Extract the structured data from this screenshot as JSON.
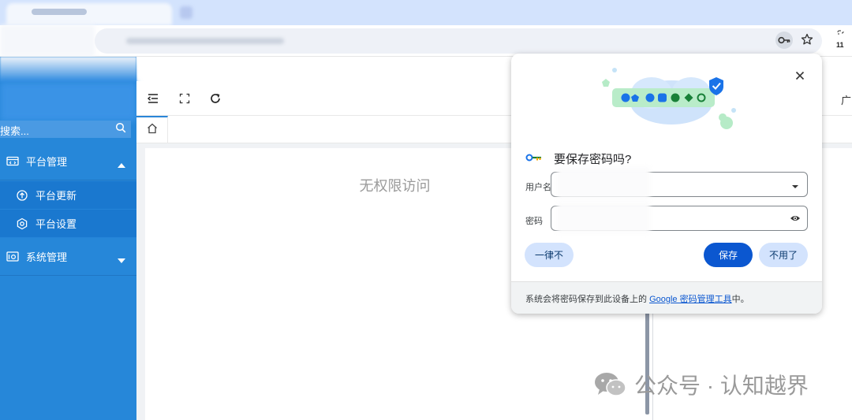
{
  "browser": {
    "extension_badge": "11"
  },
  "sidebar": {
    "search_placeholder": "搜索...",
    "groups": [
      {
        "label": "平台管理",
        "expanded": true,
        "items": [
          {
            "label": "平台更新"
          },
          {
            "label": "平台设置"
          }
        ]
      },
      {
        "label": "系统管理",
        "expanded": false,
        "items": []
      }
    ]
  },
  "content": {
    "message": "无权限访问",
    "right_cut_text": "广"
  },
  "dialog": {
    "title": "要保存密码吗?",
    "username_label": "用户名",
    "password_label": "密码",
    "never_button": "一律不",
    "save_button": "保存",
    "no_thanks_button": "不用了",
    "footer_prefix": "系统会将密码保存到此设备上的 ",
    "footer_link": "Google 密码管理工具",
    "footer_suffix": "中。"
  },
  "watermark": {
    "text": "公众号 · 认知越界"
  },
  "colors": {
    "sidebar": "#2687d9",
    "sidebar_sub": "#1a78cf",
    "accent": "#0b57d0",
    "tonal_button": "#d3e3fd"
  }
}
